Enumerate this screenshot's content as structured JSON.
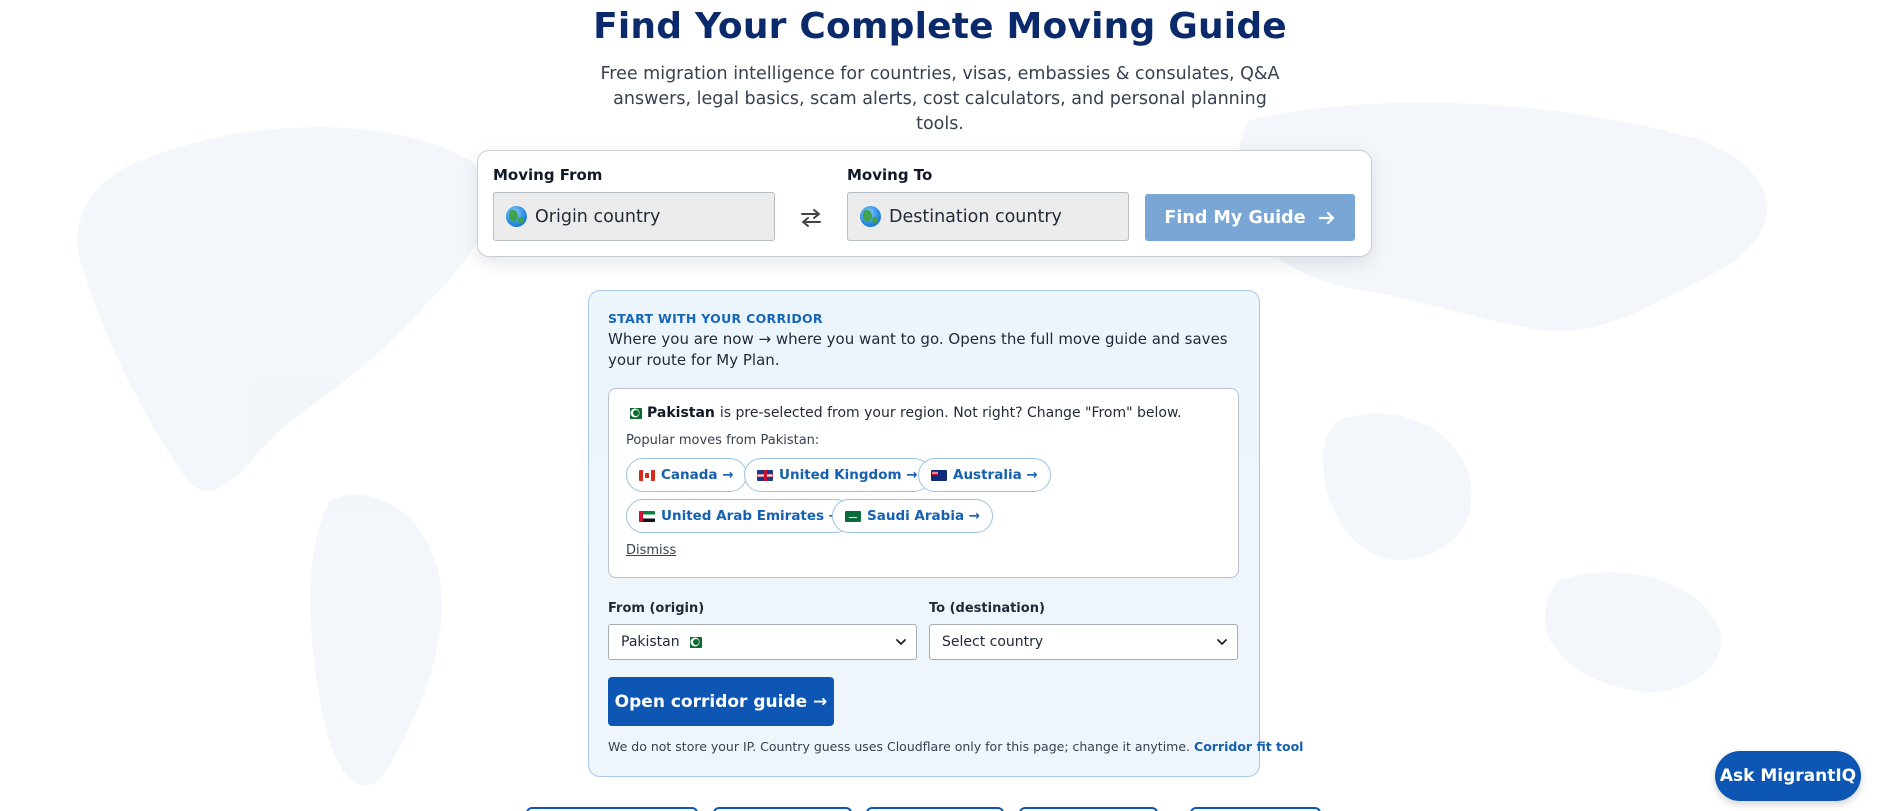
{
  "hero": {
    "title": "Find Your Complete Moving Guide",
    "subtitle": "Free migration intelligence for countries, visas, embassies & consulates, Q&A answers, legal basics, scam alerts, cost calculators, and personal planning tools."
  },
  "search": {
    "from_label": "Moving From",
    "from_placeholder": "Origin country",
    "to_label": "Moving To",
    "to_placeholder": "Destination country",
    "find_button": "Find My Guide",
    "icons": [
      "globe-icon",
      "swap-arrows-icon",
      "arrow-right-icon"
    ]
  },
  "corridor": {
    "kicker": "START WITH YOUR CORRIDOR",
    "description": "Where you are now → where you want to go. Opens the full move guide and saves your route for My Plan.",
    "detected_country": "Pakistan",
    "detected_suffix": "is pre-selected from your region. Not right? Change \"From\" below.",
    "popular_label": "Popular moves from Pakistan:",
    "popular": [
      {
        "label": "Canada →",
        "flag": "flag-canada"
      },
      {
        "label": "United Kingdom →",
        "flag": "flag-united-kingdom"
      },
      {
        "label": "Australia →",
        "flag": "flag-australia"
      },
      {
        "label": "United Arab Emirates →",
        "flag": "flag-uae"
      },
      {
        "label": "Saudi Arabia →",
        "flag": "flag-saudi-arabia"
      }
    ],
    "dismiss": "Dismiss",
    "from_select_label": "From (origin)",
    "from_select_value": "Pakistan",
    "to_select_label": "To (destination)",
    "to_select_value": "Select country",
    "open_button": "Open corridor guide →",
    "privacy_text": "We do not store your IP. Country guess uses Cloudflare only for this page; change it anytime.",
    "privacy_link": "Corridor fit tool"
  },
  "assistant": {
    "button": "Ask MigrantIQ"
  },
  "colors": {
    "title": "#0b2a6b",
    "primary": "#0d56b4",
    "find_button_disabled": "#7aa6d6",
    "panel_border": "#a9c8e8",
    "chip_text": "#1560b0"
  }
}
